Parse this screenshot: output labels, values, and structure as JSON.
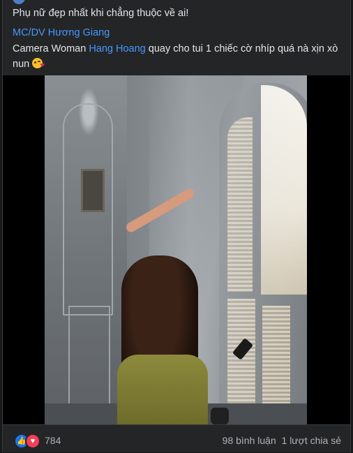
{
  "post": {
    "headline": "Phụ nữ đẹp nhất khi chẳng thuộc về ai!",
    "credit_mention": "MC/DV Hương Giang",
    "caption_prefix": "Camera Woman ",
    "caption_mention": "Hang Hoang",
    "caption_suffix": " quay cho tui 1 chiếc cờ nhíp quá nà xịn xò nun",
    "caption_emoji": "face-blowing-kiss"
  },
  "video": {
    "label": "video player"
  },
  "reactions": {
    "icons": [
      "like-icon",
      "love-icon"
    ],
    "count": "784",
    "comments": "98 bình luận",
    "shares": "1 lượt chia sẻ"
  }
}
